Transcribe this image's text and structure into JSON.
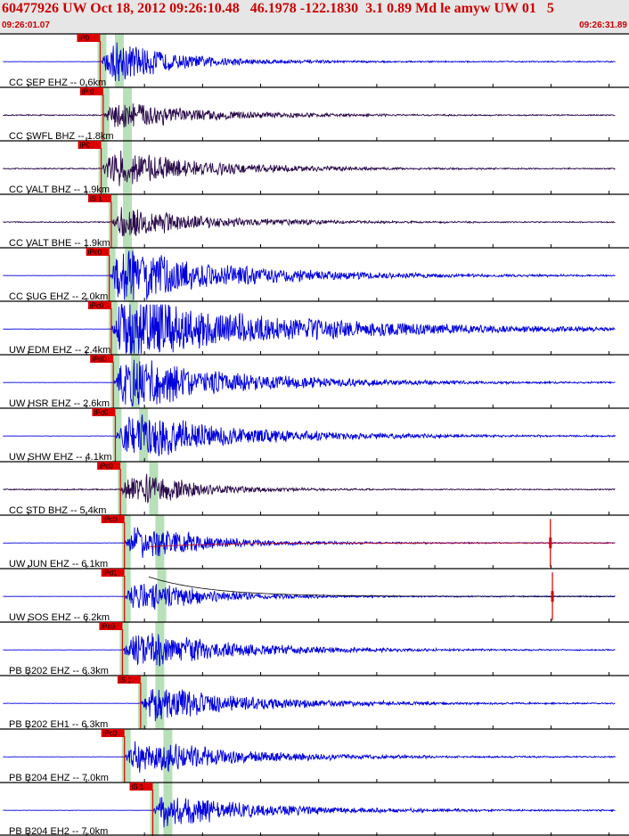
{
  "header": {
    "title": "60477926 UW Oct 18, 2012 09:26:10.48   46.1978 -122.1830  3.1 0.89 Md le amyw UW 01   5",
    "time_start": "09:26:01.07",
    "time_end": "09:26:31.89"
  },
  "colors": {
    "header_bg": "#e6e6e6",
    "header_text": "#cc0000",
    "trace_blue": "#0000dd",
    "trace_dark": "#2a0a4a",
    "window_green": "#b8e0b8",
    "pick_red": "#dd0000",
    "synthetic_red": "#cc0000"
  },
  "chart_data": {
    "type": "seismogram",
    "x_axis": {
      "unit": "s",
      "start": "09:26:01.07",
      "end": "09:26:31.89",
      "duration": 30.82
    },
    "traces": [
      {
        "label": "CC SEP EHZ -- 0.6km",
        "pick": "iP0",
        "pick_time": 4.95,
        "s_time": 5.5,
        "color": "#0000dd",
        "amp": 1.0,
        "dur": 14,
        "spike": null
      },
      {
        "label": "CC SWFL BHZ -- 1.8km",
        "pick": "iP 0",
        "pick_time": 5.1,
        "s_time": 5.9,
        "color": "#2a0a4a",
        "amp": 0.75,
        "dur": 18,
        "spike": null
      },
      {
        "label": "CC VALT BHZ -- 1.9km",
        "pick": "iP0",
        "pick_time": 5.0,
        "s_time": 5.9,
        "color": "#2a0a4a",
        "amp": 1.0,
        "dur": 18,
        "spike": null
      },
      {
        "label": "CC VALT BHE -- 1.9km",
        "pick": "iS 1",
        "pick_time": 5.5,
        "s_time": 5.9,
        "color": "#2a0a4a",
        "amp": 0.75,
        "dur": 18,
        "spike": null
      },
      {
        "label": "CC SUG EHZ -- 2.0km",
        "pick": "iPc0",
        "pick_time": 5.4,
        "s_time": 6.0,
        "color": "#0000dd",
        "amp": 1.4,
        "dur": 22,
        "spike": null
      },
      {
        "label": "UW EDM EHZ -- 2.4km",
        "pick": "iPc0",
        "pick_time": 5.5,
        "s_time": 6.2,
        "color": "#0000dd",
        "amp": 1.7,
        "dur": 32,
        "spike": null
      },
      {
        "label": "UW HSR EHZ -- 2.6km",
        "pick": "iPd0",
        "pick_time": 5.6,
        "s_time": 6.3,
        "color": "#0000dd",
        "amp": 1.35,
        "dur": 22,
        "spike": null
      },
      {
        "label": "UW SHW EHZ -- 4.1km",
        "pick": "iPd0",
        "pick_time": 5.7,
        "s_time": 6.7,
        "color": "#0000dd",
        "amp": 1.2,
        "dur": 22,
        "spike": null
      },
      {
        "label": "CC STD BHZ -- 5.4km",
        "pick": "iPc0",
        "pick_time": 5.95,
        "s_time": 7.2,
        "color": "#2a0a4a",
        "amp": 0.9,
        "dur": 12,
        "spike": null
      },
      {
        "label": "UW JUN EHZ -- 6.1km",
        "pick": "iPc0",
        "pick_time": 6.15,
        "s_time": 7.5,
        "color": "#0000dd",
        "amp": 0.9,
        "dur": 14,
        "spike": 27.2
      },
      {
        "label": "UW SOS EHZ -- 6.2km",
        "pick": "iPd1",
        "pick_time": 6.15,
        "s_time": 7.6,
        "color": "#0000dd",
        "amp": 0.8,
        "dur": 14,
        "spike": 27.3
      },
      {
        "label": "PB B202 EHZ -- 6.3km",
        "pick": "iPc0",
        "pick_time": 6.05,
        "s_time": 7.5,
        "color": "#0000dd",
        "amp": 0.95,
        "dur": 20,
        "spike": null
      },
      {
        "label": "PB B202 EH1 -- 6.3km",
        "pick": "iS 1",
        "pick_time": 6.95,
        "s_time": 7.5,
        "color": "#0000dd",
        "amp": 0.9,
        "dur": 20,
        "spike": null
      },
      {
        "label": "PB B204 EHZ -- 7.0km",
        "pick": "iPc0",
        "pick_time": 6.15,
        "s_time": 7.9,
        "color": "#0000dd",
        "amp": 0.9,
        "dur": 20,
        "spike": null
      },
      {
        "label": "PB B204 EH2 -- 7.0km",
        "pick": "iS 1",
        "pick_time": 7.55,
        "s_time": 7.9,
        "color": "#0000dd",
        "amp": 0.85,
        "dur": 20,
        "spike": null
      }
    ]
  }
}
